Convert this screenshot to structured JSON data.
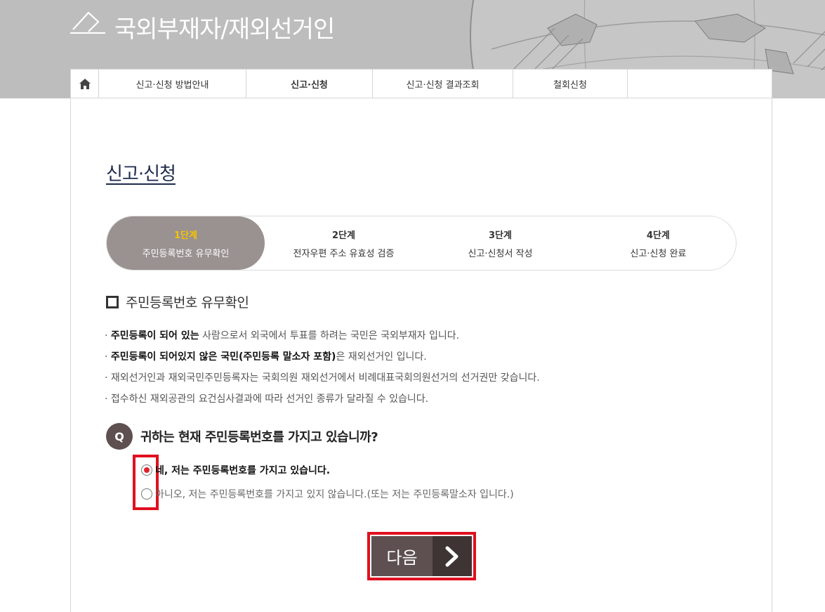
{
  "header": {
    "title": "국외부재자/재외선거인"
  },
  "nav": {
    "items": [
      "신고·신청 방법안내",
      "신고·신청",
      "신고·신청 결과조회",
      "철회신청"
    ]
  },
  "page": {
    "title": "신고·신청"
  },
  "steps": [
    {
      "num": "1단계",
      "label": "주민등록번호 유무확인"
    },
    {
      "num": "2단계",
      "label": "전자우편 주소 유효성 검증"
    },
    {
      "num": "3단계",
      "label": "신고·신청서 작성"
    },
    {
      "num": "4단계",
      "label": "신고·신청 완료"
    }
  ],
  "section": {
    "title": "주민등록번호 유무확인"
  },
  "notes": {
    "n1_bold": "주민등록이 되어 있는",
    "n1_rest": " 사람으로서 외국에서 투표를 하려는 국민은 국외부재자 입니다.",
    "n2_bold": "주민등록이 되어있지 않은 국민(주민등록 말소자 포함)",
    "n2_rest": "은 재외선거인 입니다.",
    "n3": "재외선거인과 재외국민주민등록자는 국회의원 재외선거에서 비례대표국회의원선거의 선거권만 갖습니다.",
    "n4": "접수하신 재외공관의 요건심사결과에 따라 선거인 종류가 달라질 수 있습니다.",
    "bullet": "· "
  },
  "question": {
    "badge": "Q",
    "text": "귀하는 현재 주민등록번호를 가지고 있습니까?",
    "options": [
      {
        "label": "네, 저는 주민등록번호를 가지고 있습니다.",
        "selected": true
      },
      {
        "label": "아니오, 저는 주민등록번호를 가지고 있지 않습니다.(또는 저는 주민등록말소자 입니다.)",
        "selected": false
      }
    ]
  },
  "next": {
    "label": "다음"
  },
  "colors": {
    "accent_red": "#e0101e",
    "dark_brown": "#5e5050",
    "step_active": "#9a9191",
    "step_num_active": "#f3c500"
  }
}
